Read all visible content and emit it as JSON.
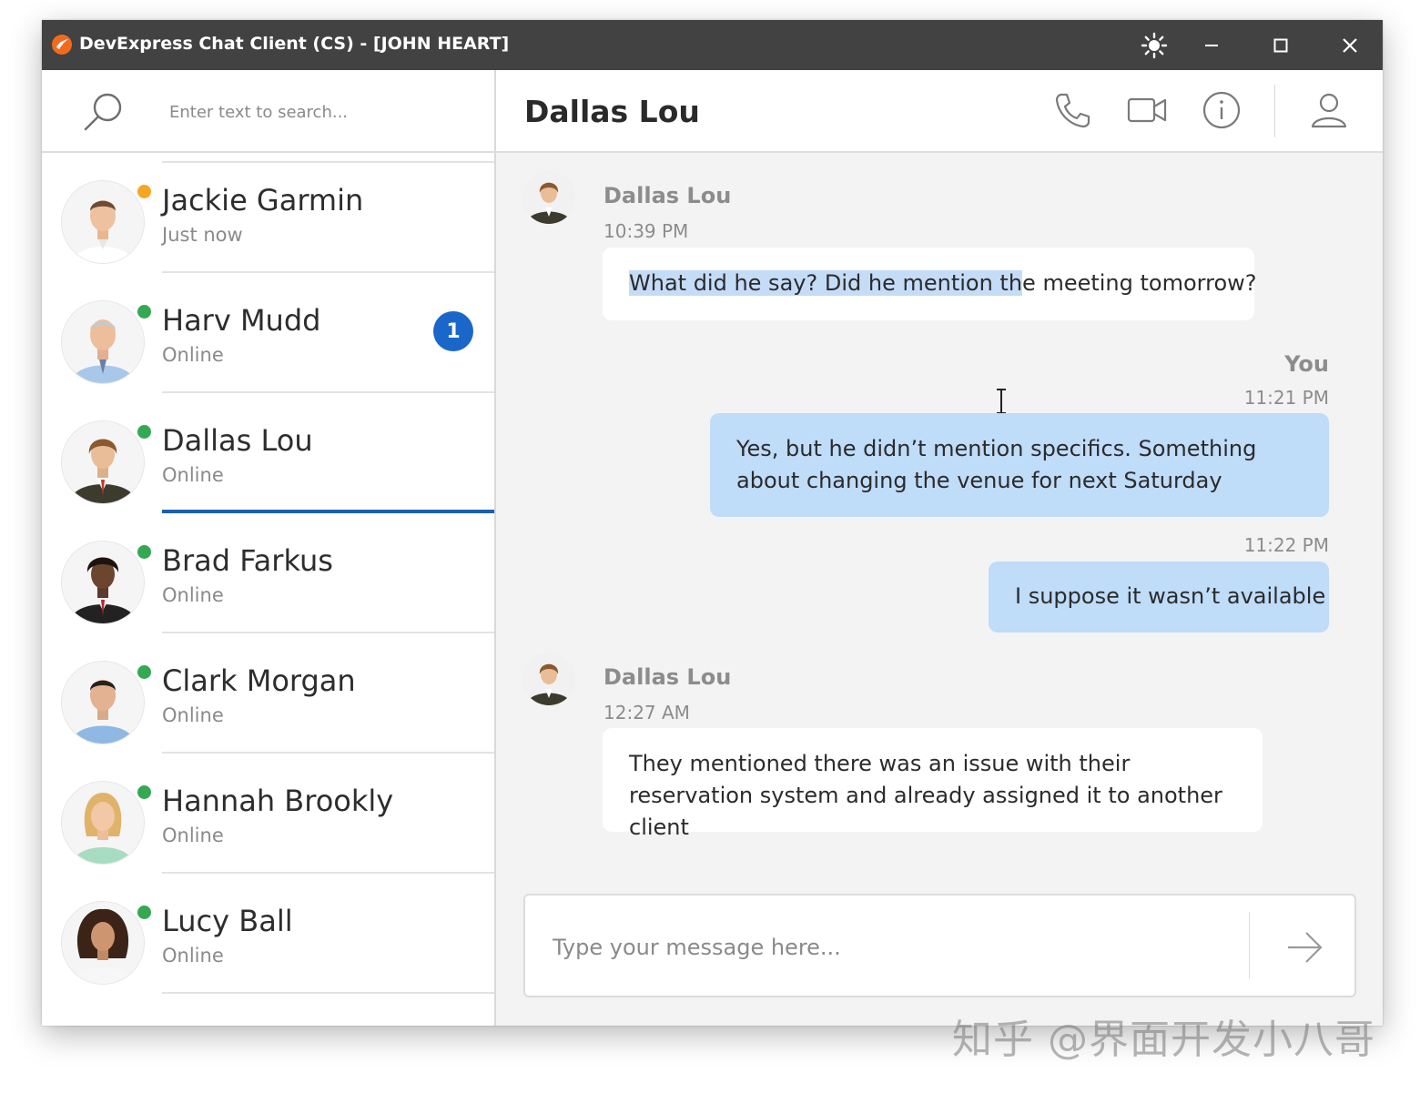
{
  "window": {
    "title": "DevExpress Chat Client (CS) - [JOHN HEART]",
    "accent": "#1b66c9",
    "titlebar_color": "#424242",
    "controls": [
      "theme-icon",
      "minimize-icon",
      "maximize-icon",
      "close-icon"
    ]
  },
  "search": {
    "placeholder": "Enter text to search..."
  },
  "contacts": [
    {
      "name": "Jackie Garmin",
      "status": "Just now",
      "presence": "away",
      "unread": null
    },
    {
      "name": "Harv Mudd",
      "status": "Online",
      "presence": "online",
      "unread": "1"
    },
    {
      "name": "Dallas Lou",
      "status": "Online",
      "presence": "online",
      "unread": null,
      "selected": true
    },
    {
      "name": "Brad Farkus",
      "status": "Online",
      "presence": "online",
      "unread": null
    },
    {
      "name": "Clark Morgan",
      "status": "Online",
      "presence": "online",
      "unread": null
    },
    {
      "name": "Hannah Brookly",
      "status": "Online",
      "presence": "online",
      "unread": null
    },
    {
      "name": "Lucy Ball",
      "status": "Online",
      "presence": "online",
      "unread": null
    }
  ],
  "chat": {
    "title": "Dallas Lou",
    "header_icons": [
      "phone-icon",
      "video-camera-icon",
      "info-icon",
      "user-profile-icon"
    ],
    "messages": [
      {
        "author": "Dallas Lou",
        "time": "10:39 PM",
        "direction": "incoming",
        "text_selected": "What did he say? Did he mention th",
        "text_rest": "e meeting tomorrow?"
      },
      {
        "author": "You",
        "time": "11:21 PM",
        "direction": "outgoing",
        "text": "Yes, but he didn’t mention specifics. Something about changing the venue for next Saturday"
      },
      {
        "time": "11:22 PM",
        "direction": "outgoing",
        "text": "I suppose it wasn’t available"
      },
      {
        "author": "Dallas Lou",
        "time": "12:27 AM",
        "direction": "incoming",
        "text": "They mentioned there was an issue with their reservation system and already assigned it to another client"
      }
    ]
  },
  "composer": {
    "placeholder": "Type your message here...",
    "send_icon": "send-arrow-icon"
  },
  "watermark": "知乎 @界面开发小八哥"
}
